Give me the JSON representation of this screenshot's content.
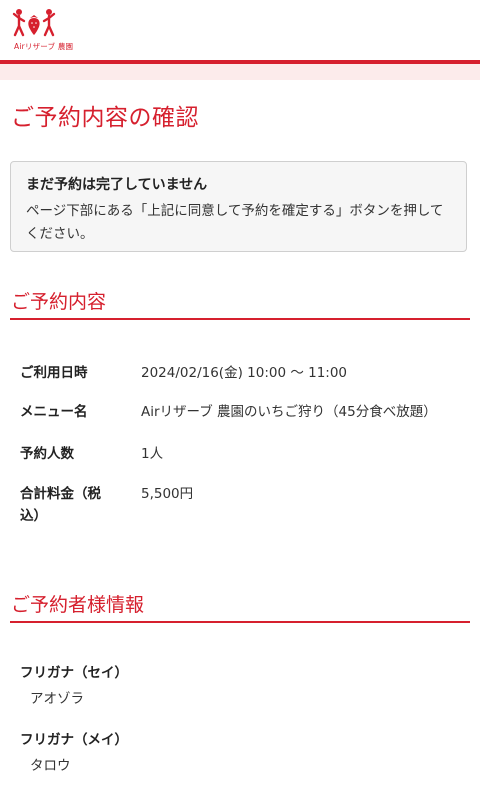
{
  "header": {
    "logo_text": "Airリザーブ 農園",
    "logo_icon": "farm-people-strawberry-icon",
    "accent_color": "#d6202e"
  },
  "page": {
    "title": "ご予約内容の確認"
  },
  "notice": {
    "title": "まだ予約は完了していません",
    "text": "ページ下部にある「上記に同意して予約を確定する」ボタンを押してください。"
  },
  "reservation": {
    "section_title": "ご予約内容",
    "rows": [
      {
        "label": "ご利用日時",
        "value": "2024/02/16(金) 10:00 〜 11:00"
      },
      {
        "label": "メニュー名",
        "value": "Airリザーブ 農園のいちご狩り（45分食べ放題）"
      },
      {
        "label": "予約人数",
        "value": "1人"
      },
      {
        "label": "合計料金（税込）",
        "value": "5,500円"
      }
    ]
  },
  "customer": {
    "section_title": "ご予約者様情報",
    "fields": [
      {
        "label": "フリガナ（セイ）",
        "value": "アオゾラ"
      },
      {
        "label": "フリガナ（メイ）",
        "value": "タロウ"
      }
    ]
  }
}
